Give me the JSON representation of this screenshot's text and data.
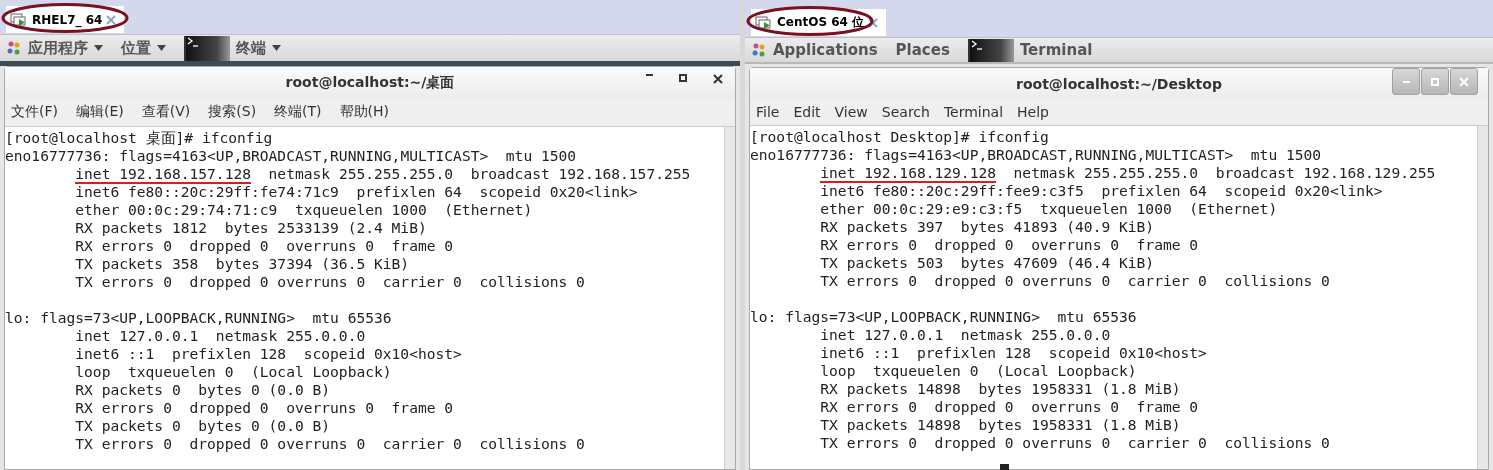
{
  "panels": [
    {
      "kind": "flat",
      "tab": {
        "label": "RHEL7_ 64",
        "circled": true
      },
      "top_menu": [
        {
          "label": "应用程序",
          "kind": "apps"
        },
        {
          "label": "位置",
          "kind": "plain"
        },
        {
          "label": "终端",
          "kind": "terminal"
        }
      ],
      "window": {
        "title": "root@localhost:~/桌面",
        "menu": [
          "文件(F)",
          "编辑(E)",
          "查看(V)",
          "搜索(S)",
          "终端(T)",
          "帮助(H)"
        ],
        "cursor": false,
        "lines": [
          {
            "kind": "text",
            "indent": false,
            "text": "[root@localhost 桌面]# ifconfig"
          },
          {
            "kind": "text",
            "indent": false,
            "text": "eno16777736: flags=4163<UP,BROADCAST,RUNNING,MULTICAST>  mtu 1500"
          },
          {
            "kind": "parts",
            "indent": true,
            "parts": [
              {
                "text": "inet 192.168.157.128",
                "underlined": true
              },
              {
                "text": "  netmask 255.255.255.0  broadcast 192.168.157.255",
                "underlined": false
              }
            ]
          },
          {
            "kind": "text",
            "indent": true,
            "text": "inet6 fe80::20c:29ff:fe74:71c9  prefixlen 64  scopeid 0x20<link>"
          },
          {
            "kind": "text",
            "indent": true,
            "text": "ether 00:0c:29:74:71:c9  txqueuelen 1000  (Ethernet)"
          },
          {
            "kind": "text",
            "indent": true,
            "text": "RX packets 1812  bytes 2533139 (2.4 MiB)"
          },
          {
            "kind": "text",
            "indent": true,
            "text": "RX errors 0  dropped 0  overruns 0  frame 0"
          },
          {
            "kind": "text",
            "indent": true,
            "text": "TX packets 358  bytes 37394 (36.5 KiB)"
          },
          {
            "kind": "text",
            "indent": true,
            "text": "TX errors 0  dropped 0 overruns 0  carrier 0  collisions 0"
          },
          {
            "kind": "blank"
          },
          {
            "kind": "text",
            "indent": false,
            "text": "lo: flags=73<UP,LOOPBACK,RUNNING>  mtu 65536"
          },
          {
            "kind": "text",
            "indent": true,
            "text": "inet 127.0.0.1  netmask 255.0.0.0"
          },
          {
            "kind": "text",
            "indent": true,
            "text": "inet6 ::1  prefixlen 128  scopeid 0x10<host>"
          },
          {
            "kind": "text",
            "indent": true,
            "text": "loop  txqueuelen 0  (Local Loopback)"
          },
          {
            "kind": "text",
            "indent": true,
            "text": "RX packets 0  bytes 0 (0.0 B)"
          },
          {
            "kind": "text",
            "indent": true,
            "text": "RX errors 0  dropped 0  overruns 0  frame 0"
          },
          {
            "kind": "text",
            "indent": true,
            "text": "TX packets 0  bytes 0 (0.0 B)"
          },
          {
            "kind": "text",
            "indent": true,
            "text": "TX errors 0  dropped 0 overruns 0  carrier 0  collisions 0"
          }
        ]
      }
    },
    {
      "kind": "boxed",
      "tab": {
        "label": "CentOS 64 位",
        "circled": true
      },
      "top_menu": [
        {
          "label": "Applications",
          "kind": "apps"
        },
        {
          "label": "Places",
          "kind": "plain"
        },
        {
          "label": "Terminal",
          "kind": "terminal"
        }
      ],
      "window": {
        "title": "root@localhost:~/Desktop",
        "menu": [
          "File",
          "Edit",
          "View",
          "Search",
          "Terminal",
          "Help"
        ],
        "cursor": true,
        "lines": [
          {
            "kind": "text",
            "indent": false,
            "text": "[root@localhost Desktop]# ifconfig"
          },
          {
            "kind": "text",
            "indent": false,
            "text": "eno16777736: flags=4163<UP,BROADCAST,RUNNING,MULTICAST>  mtu 1500"
          },
          {
            "kind": "parts",
            "indent": true,
            "parts": [
              {
                "text": "inet 192.168.129.128",
                "underlined": true
              },
              {
                "text": "  netmask 255.255.255.0  broadcast 192.168.129.255",
                "underlined": false
              }
            ]
          },
          {
            "kind": "text",
            "indent": true,
            "text": "inet6 fe80::20c:29ff:fee9:c3f5  prefixlen 64  scopeid 0x20<link>"
          },
          {
            "kind": "text",
            "indent": true,
            "text": "ether 00:0c:29:e9:c3:f5  txqueuelen 1000  (Ethernet)"
          },
          {
            "kind": "text",
            "indent": true,
            "text": "RX packets 397  bytes 41893 (40.9 KiB)"
          },
          {
            "kind": "text",
            "indent": true,
            "text": "RX errors 0  dropped 0  overruns 0  frame 0"
          },
          {
            "kind": "text",
            "indent": true,
            "text": "TX packets 503  bytes 47609 (46.4 KiB)"
          },
          {
            "kind": "text",
            "indent": true,
            "text": "TX errors 0  dropped 0 overruns 0  carrier 0  collisions 0"
          },
          {
            "kind": "blank"
          },
          {
            "kind": "text",
            "indent": false,
            "text": "lo: flags=73<UP,LOOPBACK,RUNNING>  mtu 65536"
          },
          {
            "kind": "text",
            "indent": true,
            "text": "inet 127.0.0.1  netmask 255.0.0.0"
          },
          {
            "kind": "text",
            "indent": true,
            "text": "inet6 ::1  prefixlen 128  scopeid 0x10<host>"
          },
          {
            "kind": "text",
            "indent": true,
            "text": "loop  txqueuelen 0  (Local Loopback)"
          },
          {
            "kind": "text",
            "indent": true,
            "text": "RX packets 14898  bytes 1958331 (1.8 MiB)"
          },
          {
            "kind": "text",
            "indent": true,
            "text": "RX errors 0  dropped 0  overruns 0  frame 0"
          },
          {
            "kind": "text",
            "indent": true,
            "text": "TX packets 14898  bytes 1958331 (1.8 MiB)"
          },
          {
            "kind": "text",
            "indent": true,
            "text": "TX errors 0  dropped 0 overruns 0  carrier 0  collisions 0"
          }
        ]
      }
    }
  ]
}
